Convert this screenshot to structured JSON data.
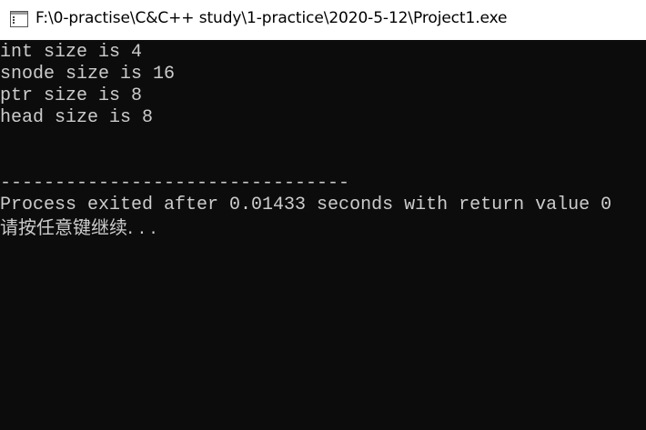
{
  "window": {
    "title": "F:\\0-practise\\C&C++ study\\1-practice\\2020-5-12\\Project1.exe",
    "icon": "console-window-icon"
  },
  "console": {
    "lines": [
      "int size is 4",
      "snode size is 16",
      "ptr size is 8",
      "head size is 8",
      "--------------------------------",
      "Process exited after 0.01433 seconds with return value 0",
      "请按任意键继续. . ."
    ],
    "text_color": "#cccccc",
    "background": "#0c0c0c"
  }
}
